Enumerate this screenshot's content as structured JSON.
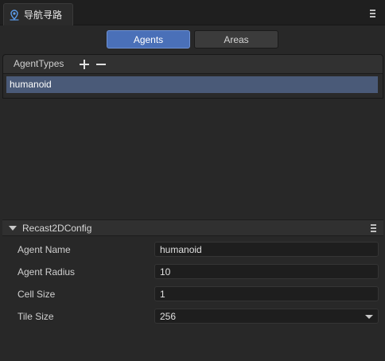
{
  "tab": {
    "title": "导航寻路",
    "icon": "navigation-icon"
  },
  "modes": {
    "agents_label": "Agents",
    "areas_label": "Areas",
    "active": "Agents"
  },
  "agent_types": {
    "header": "AgentTypes",
    "add_icon": "plus-icon",
    "remove_icon": "minus-icon",
    "items": [
      "humanoid"
    ],
    "selected": "humanoid"
  },
  "config": {
    "title": "Recast2DConfig",
    "properties": [
      {
        "label": "Agent Name",
        "value": "humanoid"
      },
      {
        "label": "Agent Radius",
        "value": "10"
      },
      {
        "label": "Cell Size",
        "value": "1"
      },
      {
        "label": "Tile Size",
        "value": "256"
      }
    ]
  },
  "colors": {
    "accent": "#4a70b8",
    "selection": "#4a5a78",
    "background": "#282828"
  }
}
